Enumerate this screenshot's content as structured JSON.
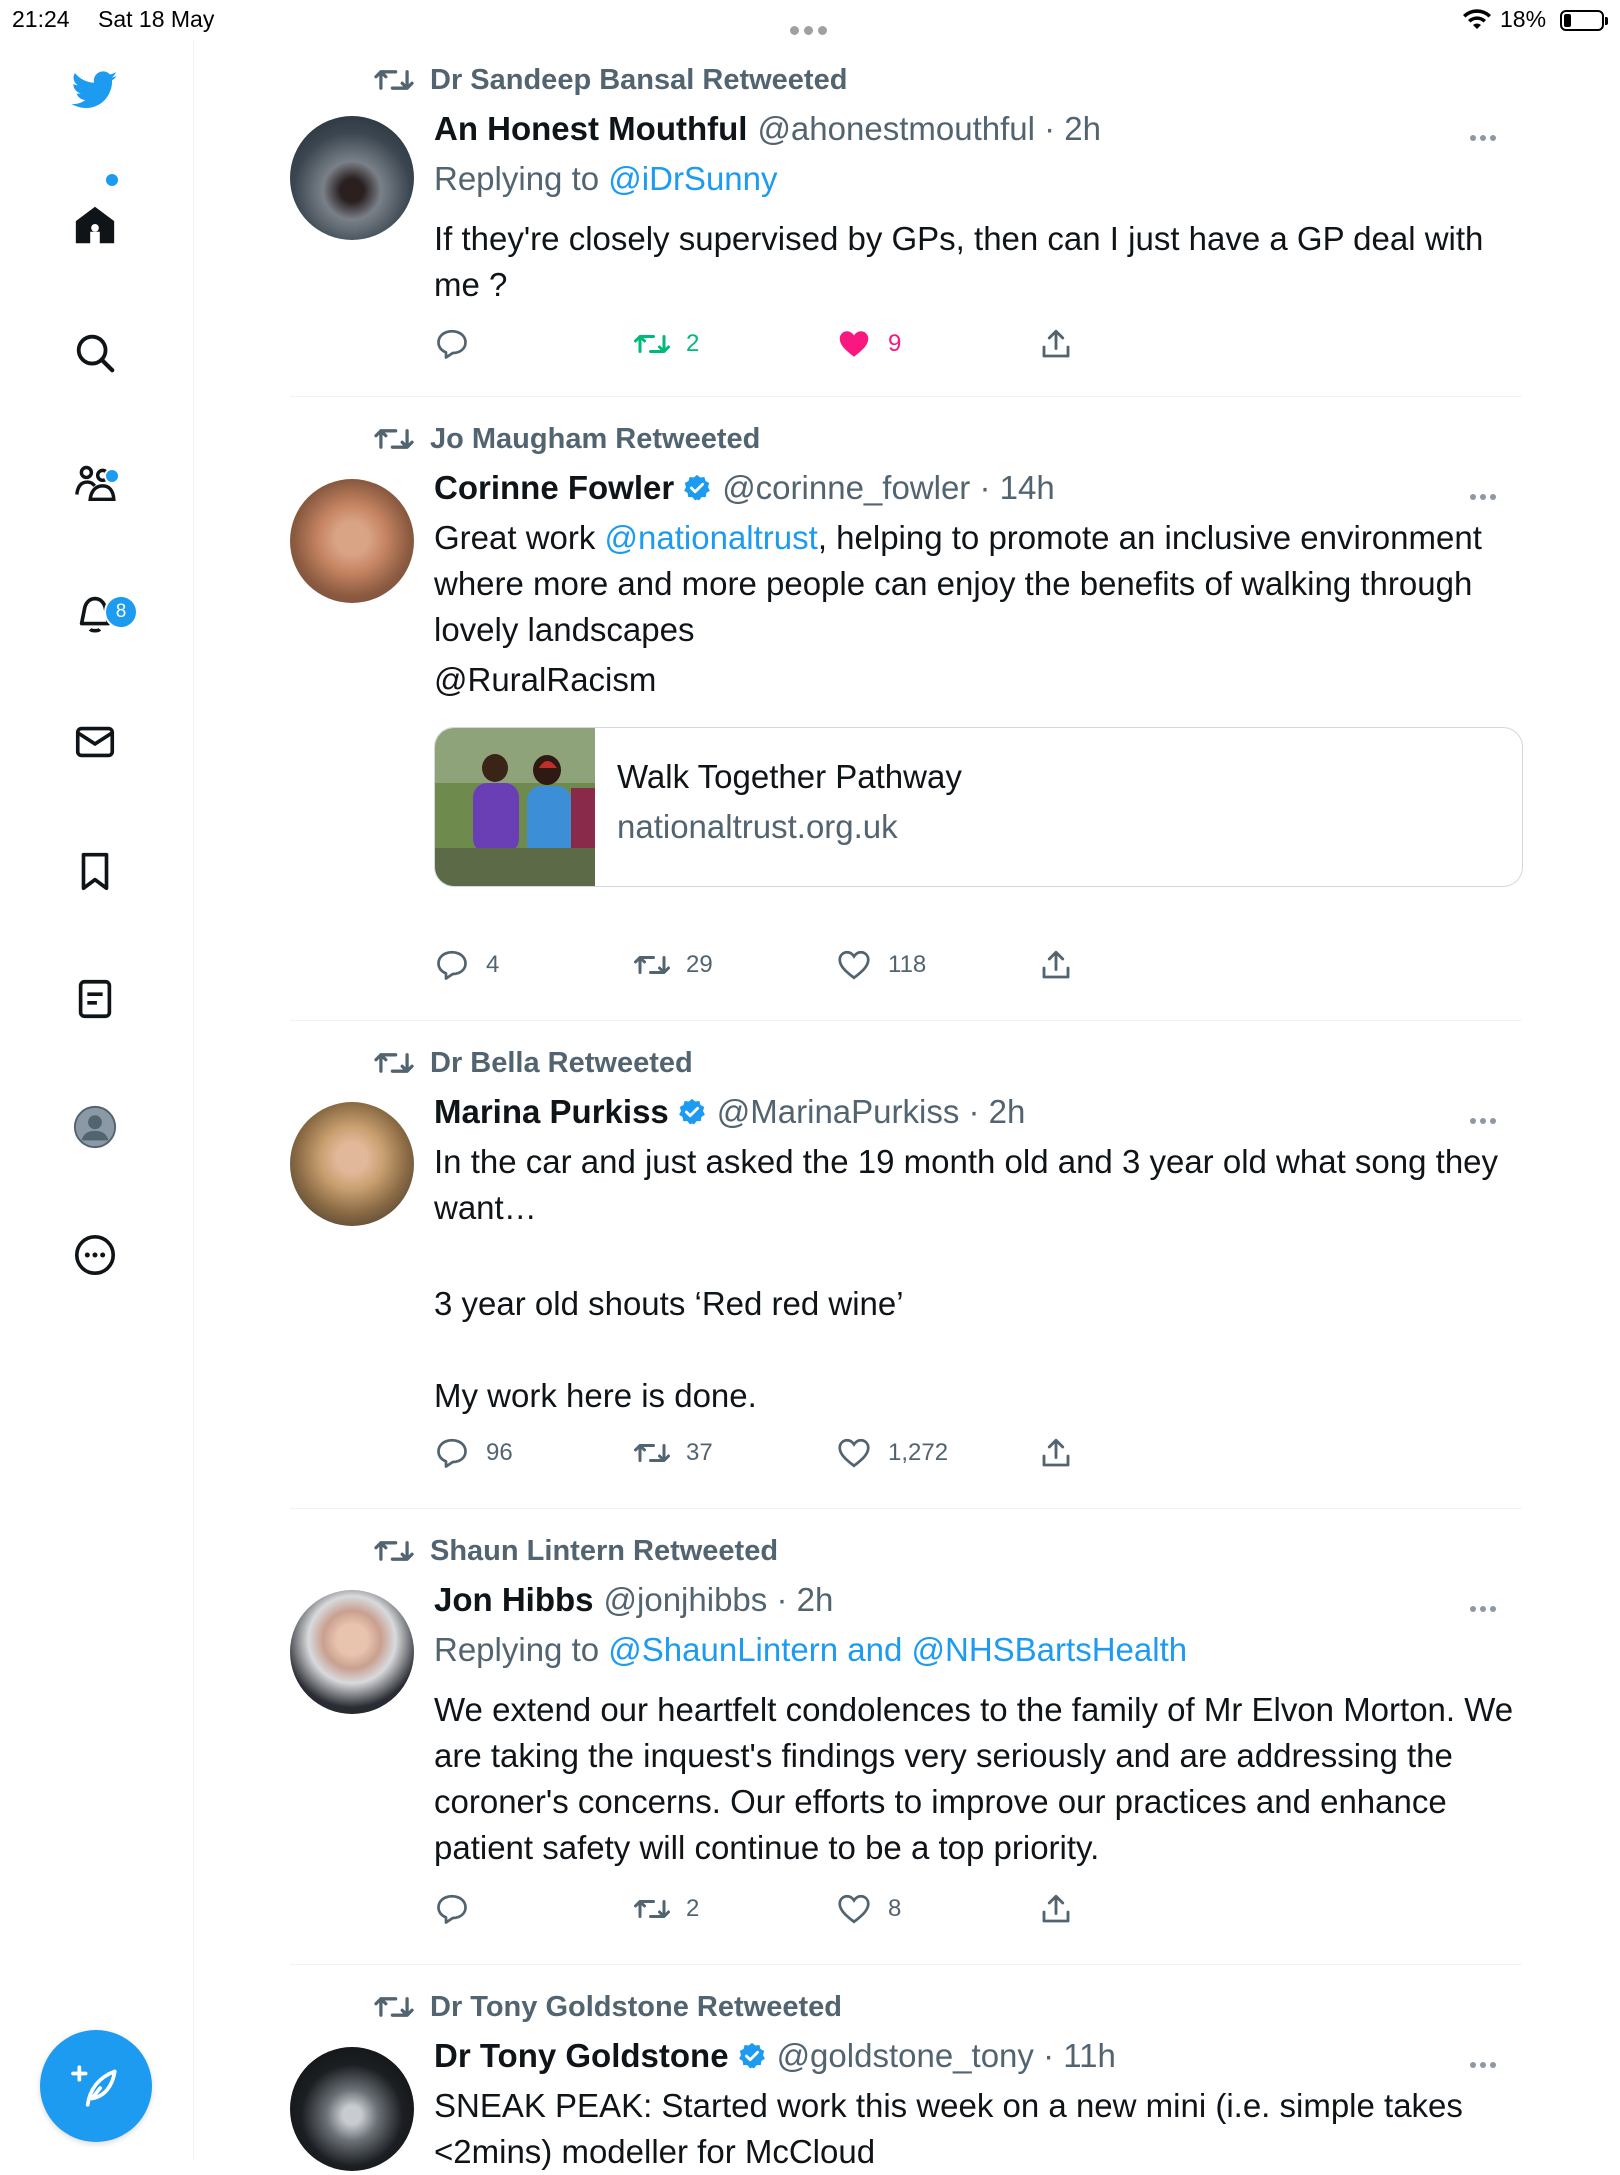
{
  "status_bar": {
    "time": "21:24",
    "date": "Sat 18 May",
    "battery": "18%"
  },
  "sidebar": {
    "items": [
      {
        "name": "home"
      },
      {
        "name": "explore"
      },
      {
        "name": "communities"
      },
      {
        "name": "notifications",
        "badge": "8"
      },
      {
        "name": "messages"
      },
      {
        "name": "bookmarks"
      },
      {
        "name": "lists"
      },
      {
        "name": "profile"
      },
      {
        "name": "more"
      }
    ]
  },
  "tweets": [
    {
      "retweeted_by": "Dr Sandeep Bansal Retweeted",
      "name": "An Honest Mouthful",
      "handle_time": "@ahonestmouthful · 2h",
      "replying_prefix": "Replying to",
      "replying_to": "@iDrSunny",
      "text": "If they're closely supervised by GPs, then can I just have a GP deal with me ?",
      "retweets": "2",
      "likes": "9"
    },
    {
      "retweeted_by": "Jo Maugham Retweeted",
      "name": "Corinne Fowler",
      "handle_time": "@corinne_fowler · 14h",
      "text_pre": "Great work ",
      "mention": "@nationaltrust",
      "text_post": ", helping to promote an inclusive environment where more and more people can enjoy the benefits of walking through lovely landscapes",
      "hashtag_mention": "@RuralRacism",
      "card": {
        "title": "Walk Together Pathway",
        "domain": "nationaltrust.org.uk"
      },
      "replies": "4",
      "retweets": "29",
      "likes": "118"
    },
    {
      "retweeted_by": "Dr Bella Retweeted",
      "name": "Marina Purkiss",
      "handle_time": "@MarinaPurkiss · 2h",
      "text_p1": "In the car and just asked the 19 month old and 3 year old what song they want…",
      "text_p2": "3 year old shouts ‘Red red wine’",
      "text_p3": "My work here is done.",
      "replies": "96",
      "retweets": "37",
      "likes": "1,272"
    },
    {
      "retweeted_by": "Shaun Lintern Retweeted",
      "name": "Jon Hibbs",
      "handle_time": "@jonjhibbs · 2h",
      "replying_prefix": "Replying to",
      "replying_to": "@ShaunLintern and @NHSBartsHealth",
      "text": "We extend our heartfelt condolences to the family of Mr Elvon Morton. We are taking the inquest's findings very seriously and are addressing the coroner's concerns. Our efforts to improve our practices and enhance patient safety will continue to be a top priority.",
      "retweets": "2",
      "likes": "8"
    },
    {
      "retweeted_by": "Dr Tony Goldstone Retweeted",
      "name": "Dr Tony Goldstone",
      "handle_time": "@goldstone_tony · 11h",
      "text": "SNEAK PEAK: Started work this week on a new mini (i.e. simple takes <2mins) modeller for McCloud"
    }
  ],
  "colors": {
    "accent": "#1d9bf0",
    "retweet_active": "#00ba7c",
    "like_active": "#f91880",
    "muted": "#536471"
  }
}
